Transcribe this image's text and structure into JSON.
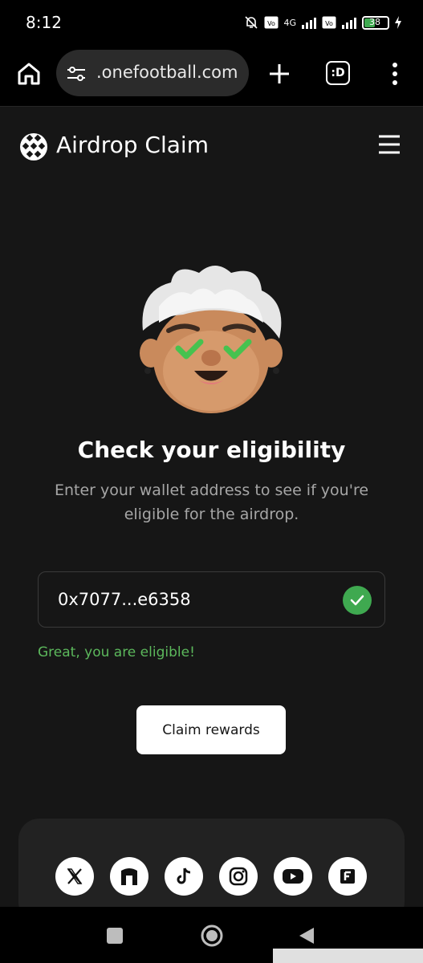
{
  "status_bar": {
    "time": "8:12",
    "network": "4G",
    "battery": "38"
  },
  "browser": {
    "url": ".onefootball.com",
    "tab_button": ":D",
    "icons": [
      "home-icon",
      "tune-icon",
      "plus-icon",
      "tab-switcher-icon",
      "more-vert-icon"
    ]
  },
  "header": {
    "title": "Airdrop Claim",
    "logo": "onefootball-logo",
    "menu_icon": "hamburger-menu-icon"
  },
  "main": {
    "heading": "Check your eligibility",
    "subtext": "Enter your wallet address to see if you're eligible for the airdrop.",
    "wallet_value": "0x7077...e6358",
    "eligible_message": "Great, you are eligible!",
    "claim_button": "Claim rewards"
  },
  "footer": {
    "socials": [
      "x-icon",
      "gate-icon",
      "tiktok-icon",
      "instagram-icon",
      "youtube-icon",
      "f-logo-icon"
    ]
  },
  "colors": {
    "background": "#161616",
    "accent_green": "#3fa950",
    "success_text": "#5cb85c"
  }
}
